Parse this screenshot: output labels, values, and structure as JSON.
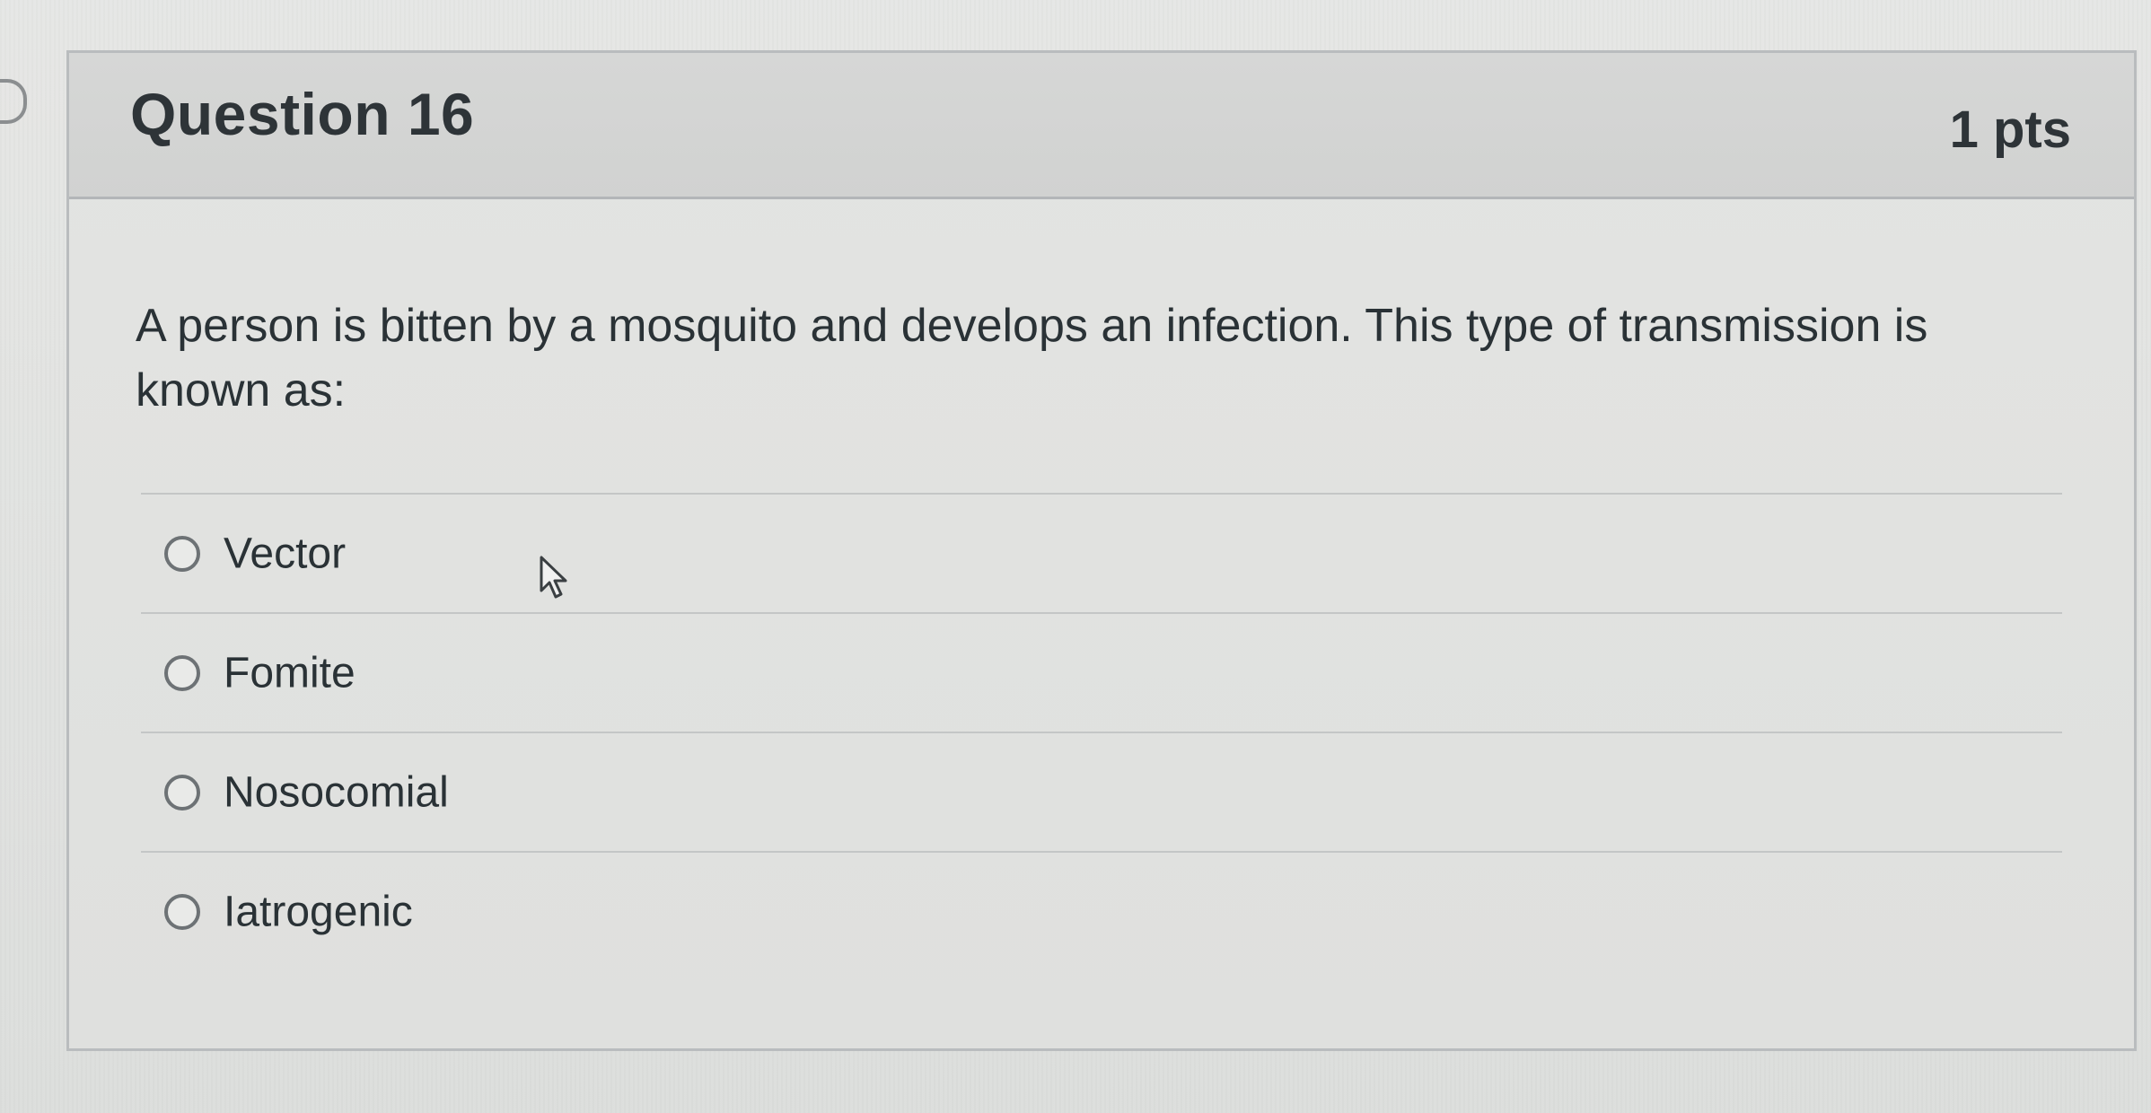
{
  "question": {
    "title": "Question 16",
    "points": "1 pts",
    "text": "A person is bitten by a mosquito and develops an infection.  This type of transmission is known as:"
  },
  "answers": [
    {
      "label": "Vector",
      "selected": false
    },
    {
      "label": "Fomite",
      "selected": false
    },
    {
      "label": "Nosocomial",
      "selected": false
    },
    {
      "label": "Iatrogenic",
      "selected": false
    }
  ],
  "icons": {
    "nav_flag": "flag-icon",
    "cursor": "mouse-pointer-icon"
  }
}
